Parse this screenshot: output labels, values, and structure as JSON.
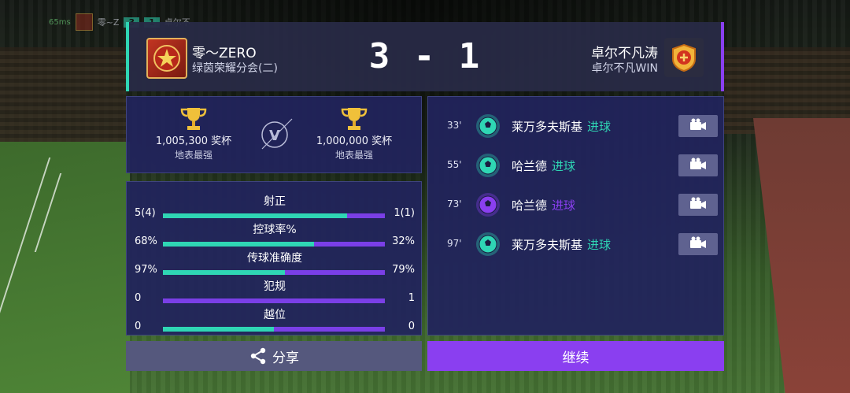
{
  "hud": {
    "ping": "65ms",
    "team_left_short": "零~Z",
    "score_left": "3",
    "score_right": "1",
    "team_right_short": "卓尔不"
  },
  "header": {
    "home_name": "零～ZERO",
    "home_sub": "绿茵荣耀分会(二)",
    "score": "3 - 1",
    "away_name": "卓尔不凡涛",
    "away_sub": "卓尔不凡WIN",
    "accent_home": "#2fd6b4",
    "accent_away": "#8a3ff0"
  },
  "trophies": {
    "home": {
      "amount": "1,005,300 奖杯",
      "rank": "地表最强",
      "icon": "trophy-icon"
    },
    "away": {
      "amount": "1,000,000 奖杯",
      "rank": "地表最强",
      "icon": "trophy-icon"
    },
    "vs_label": "V"
  },
  "stats": [
    {
      "label": "射正",
      "home": "5(4)",
      "away": "1(1)",
      "home_share": 0.83
    },
    {
      "label": "控球率%",
      "home": "68%",
      "away": "32%",
      "home_share": 0.68
    },
    {
      "label": "传球准确度",
      "home": "97%",
      "away": "79%",
      "home_share": 0.55
    },
    {
      "label": "犯规",
      "home": "0",
      "away": "1",
      "home_share": 0.0
    },
    {
      "label": "越位",
      "home": "0",
      "away": "0",
      "home_share": 0.5
    }
  ],
  "events": [
    {
      "minute": "33'",
      "player": "莱万多夫斯基",
      "type": "进球",
      "team": "home",
      "icon": "soccer-ball-icon",
      "action_icon": "video-camera-icon"
    },
    {
      "minute": "55'",
      "player": "哈兰德",
      "type": "进球",
      "team": "home",
      "icon": "soccer-ball-icon",
      "action_icon": "video-camera-icon"
    },
    {
      "minute": "73'",
      "player": "哈兰德",
      "type": "进球",
      "team": "away",
      "icon": "soccer-ball-icon",
      "action_icon": "video-camera-icon"
    },
    {
      "minute": "97'",
      "player": "莱万多夫斯基",
      "type": "进球",
      "team": "home",
      "icon": "soccer-ball-icon",
      "action_icon": "video-camera-icon"
    }
  ],
  "buttons": {
    "share_label": "分享",
    "share_icon": "share-icon",
    "continue_label": "继续"
  },
  "colors": {
    "home": "#2fd6b4",
    "away": "#8a3ff0"
  }
}
